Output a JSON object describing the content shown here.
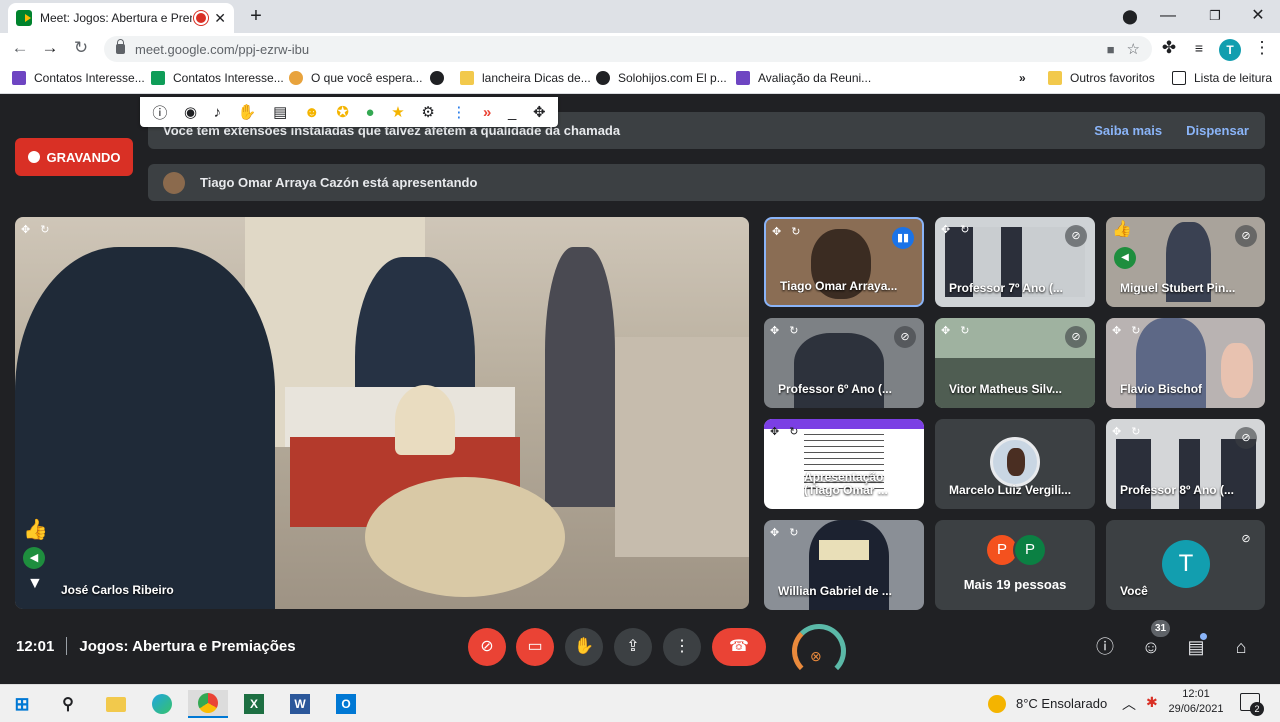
{
  "browser": {
    "tab_title": "Meet: Jogos: Abertura e Pren",
    "url": "meet.google.com/ppj-ezrw-ibu",
    "profile_initial": "T",
    "bookmarks": [
      "Contatos Interesse...",
      "Contatos Interesse...",
      "O que você espera...",
      "",
      "lancheira Dicas de...",
      "Solohijos.com  El p...",
      "Avaliação da Reuni..."
    ],
    "other_favorites": "Outros favoritos",
    "reading_list": "Lista de leitura"
  },
  "meet": {
    "extension_banner": "Você tem extensões instaladas que talvez afetem a qualidade da chamada",
    "learn_more": "Saiba mais",
    "dismiss": "Dispensar",
    "recording": "GRAVANDO",
    "presenting": "Tiago Omar Arraya Cazón está apresentando",
    "main_speaker": "José Carlos Ribeiro",
    "participants": [
      "Tiago Omar Arraya...",
      "Professor 7º Ano (...",
      "Miguel Stubert Pin...",
      "Professor 6º Ano (...",
      "Vitor Matheus Silv...",
      "Flavio Bischof",
      "Apresentação (Tiago Omar ...",
      "Marcelo Luiz Vergili...",
      "Professor 8º Ano (...",
      "Willian Gabriel de ...",
      "Mais 19 pessoas",
      "Você"
    ],
    "more_avatars": [
      "P",
      "P"
    ],
    "you_initial": "T",
    "time": "12:01",
    "meeting_title": "Jogos: Abertura e Premiações",
    "people_count": "31"
  },
  "taskbar": {
    "weather": "8°C  Ensolarado",
    "clock_time": "12:01",
    "clock_date": "29/06/2021",
    "notifications": "2"
  },
  "colors": {
    "red": "#ea4335",
    "teal": "#129eaf",
    "dark": "#202124"
  }
}
